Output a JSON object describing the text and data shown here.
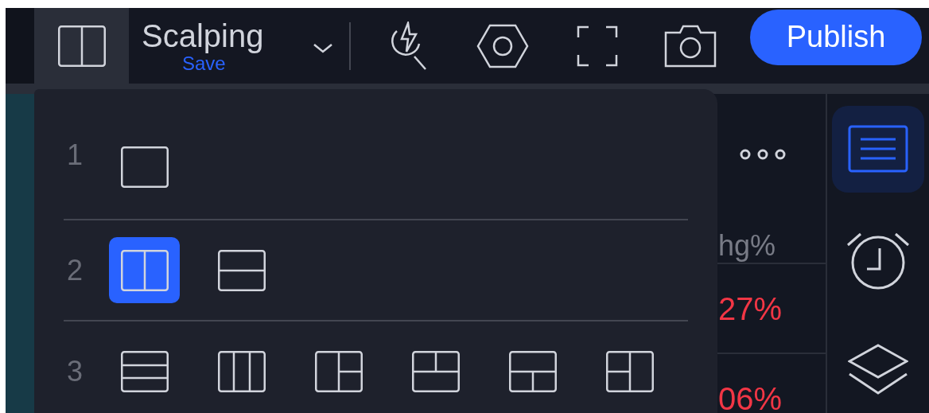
{
  "toolbar": {
    "layout_name": "Scalping",
    "save": "Save",
    "publish": "Publish"
  },
  "layout_menu": {
    "rows": [
      {
        "label": "1",
        "options": [
          {
            "kind": "single",
            "selected": false
          }
        ]
      },
      {
        "label": "2",
        "options": [
          {
            "kind": "cols2",
            "selected": true
          },
          {
            "kind": "rows2",
            "selected": false
          }
        ]
      },
      {
        "label": "3",
        "options": [
          {
            "kind": "rows3",
            "selected": false
          },
          {
            "kind": "cols3",
            "selected": false
          },
          {
            "kind": "left_big",
            "selected": false
          },
          {
            "kind": "top_split",
            "selected": false
          },
          {
            "kind": "bottom_split",
            "selected": false
          },
          {
            "kind": "right_split",
            "selected": false
          }
        ]
      }
    ]
  },
  "watchlist": {
    "header": "hg%",
    "rows": [
      {
        "change": "27%",
        "negative": true
      },
      {
        "change": "06%",
        "negative": true
      }
    ]
  },
  "right_sidebar": [
    {
      "kind": "watchlist",
      "selected": true
    },
    {
      "kind": "alerts",
      "selected": false
    },
    {
      "kind": "layers",
      "selected": false
    }
  ]
}
